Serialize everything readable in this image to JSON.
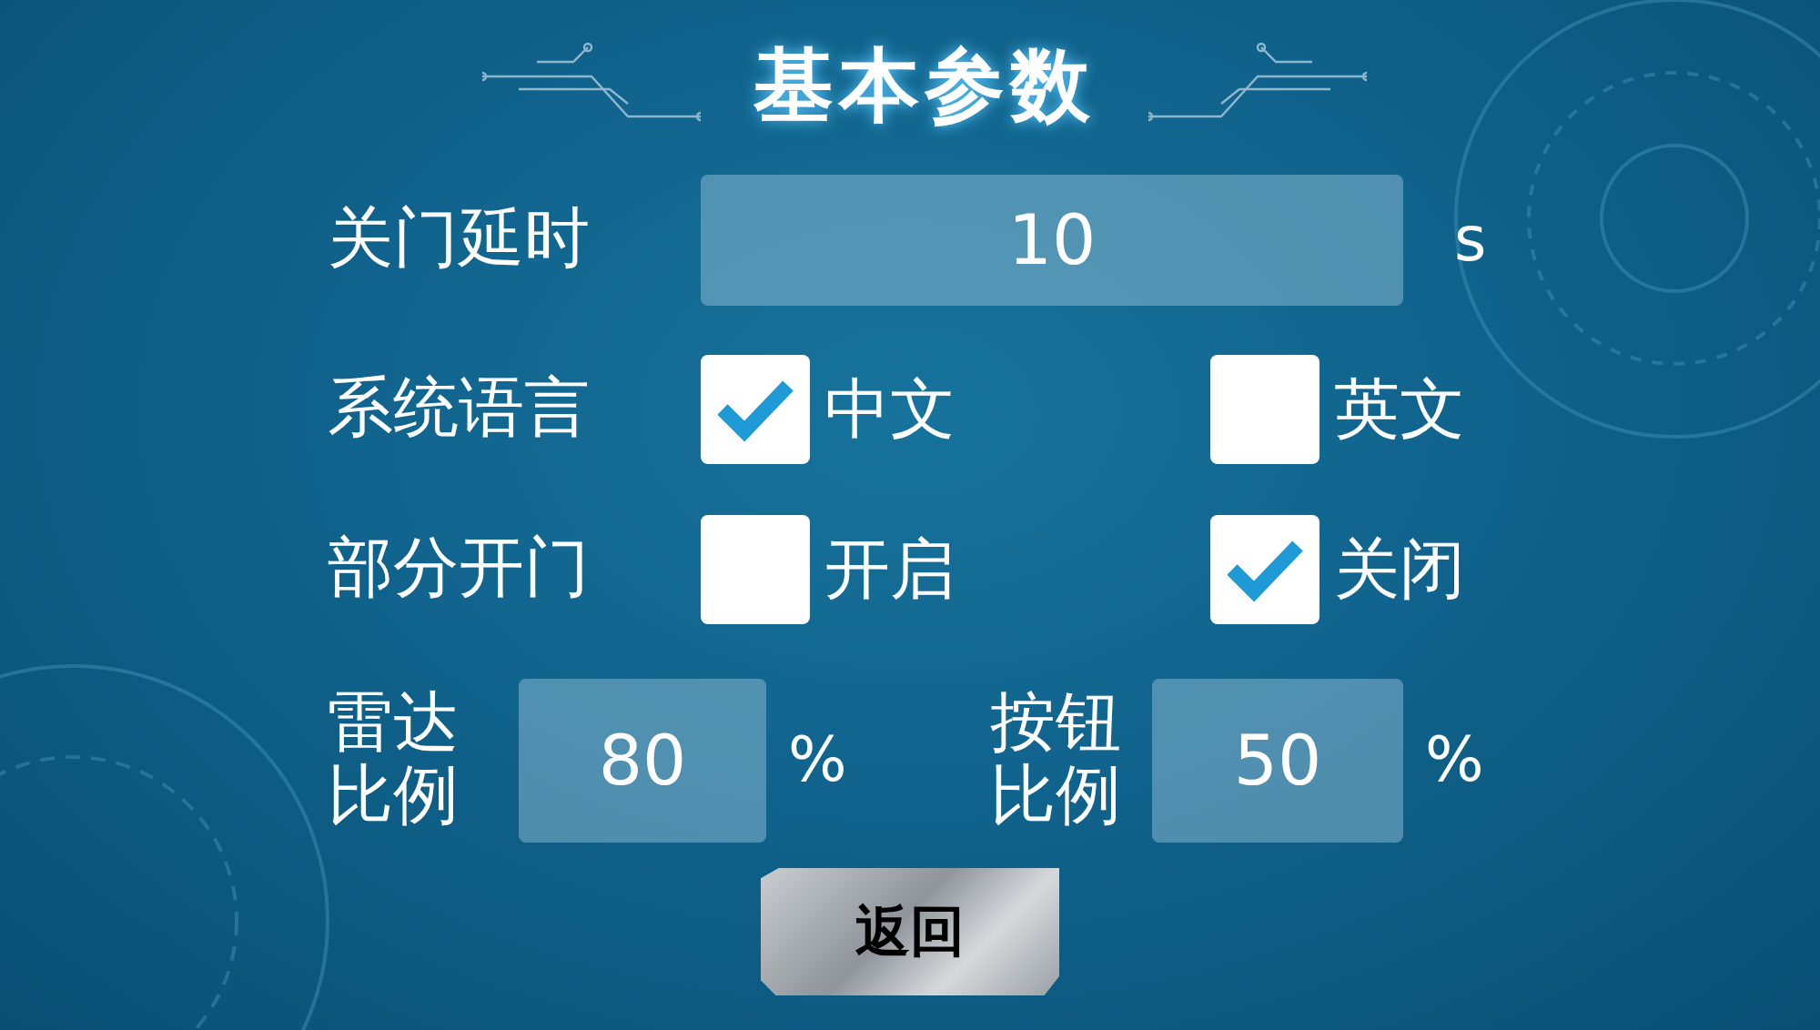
{
  "title": "基本参数",
  "door_delay": {
    "label": "关门延时",
    "value": "10",
    "unit": "s"
  },
  "options": [
    {
      "label": "系统语言",
      "choices": [
        {
          "label": "中文",
          "checked": true
        },
        {
          "label": "英文",
          "checked": false
        }
      ]
    },
    {
      "label": "部分开门",
      "choices": [
        {
          "label": "开启",
          "checked": false
        },
        {
          "label": "关闭",
          "checked": true
        }
      ]
    }
  ],
  "ratios": [
    {
      "label": "雷达比例",
      "value": "80",
      "unit": "%"
    },
    {
      "label": "按钮比例",
      "value": "50",
      "unit": "%"
    }
  ],
  "back_button": "返回"
}
